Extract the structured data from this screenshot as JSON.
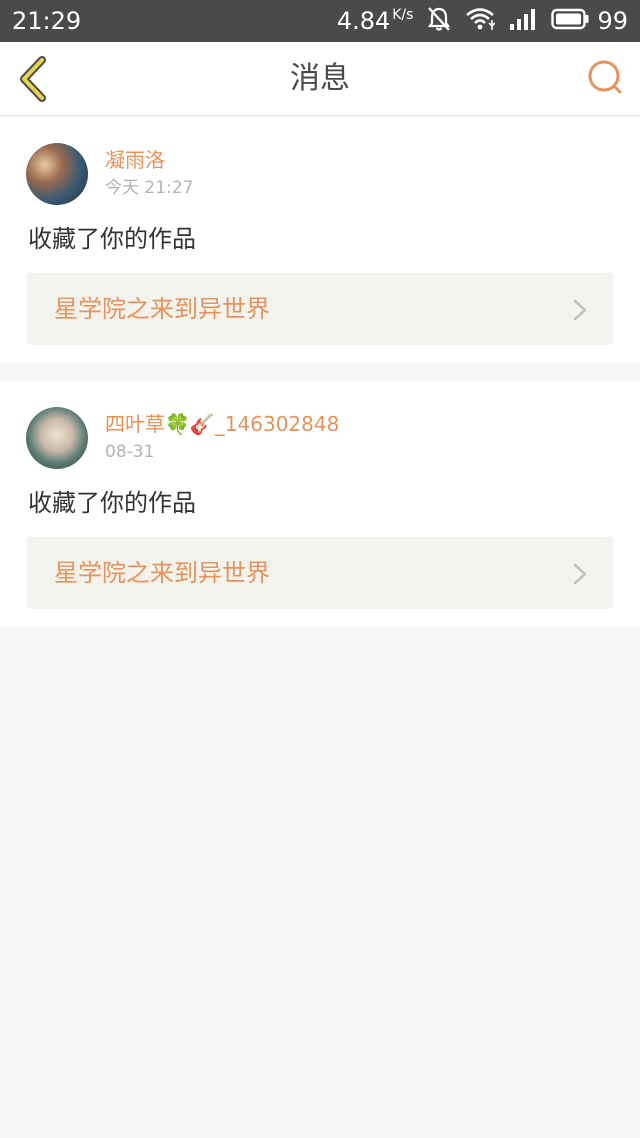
{
  "status_bar": {
    "time": "21:29",
    "net_speed": "4.84",
    "net_speed_unit": "K/s",
    "battery": "99"
  },
  "header": {
    "title": "消息"
  },
  "colors": {
    "accent": "#e5935b",
    "back_icon": "#e6d44a"
  },
  "messages": [
    {
      "user_name": "凝雨洛",
      "time": "今天 21:27",
      "action": "收藏了你的作品",
      "work_title": "星学院之来到异世界"
    },
    {
      "user_name": "四叶草🍀🎸_146302848",
      "time": "08-31",
      "action": "收藏了你的作品",
      "work_title": "星学院之来到异世界"
    }
  ]
}
